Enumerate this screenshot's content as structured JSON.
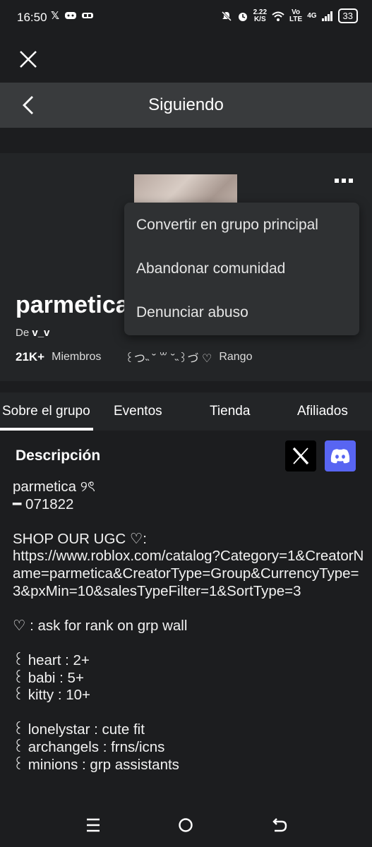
{
  "status_bar": {
    "time": "16:50",
    "net_speed_top": "2.22",
    "net_speed_bottom": "K/S",
    "volte_top": "Vo",
    "volte_bottom": "LTE",
    "network": "4G",
    "battery": "33"
  },
  "header": {
    "title": "Siguiendo"
  },
  "group": {
    "name": "parmetica",
    "owner_prefix": "De",
    "owner": "v_v",
    "members_count": "21K+",
    "members_label": "Miembros",
    "rank_value": "꒰つ˵ ˘ ꒳ ˘˵꒱づ ♡",
    "rank_label": "Rango"
  },
  "menu": {
    "items": [
      "Convertir en grupo principal",
      "Abandonar comunidad",
      "Denunciar abuso"
    ]
  },
  "tabs": [
    "Sobre el grupo",
    "Eventos",
    "Tienda",
    "Afiliados"
  ],
  "content": {
    "title": "Descripción",
    "description_lines": [
      "parmetica ୨ৎ",
      "━ 071822",
      "",
      "SHOP OUR UGC ♡:",
      "https://www.roblox.com/catalog?Category=1&CreatorName=parmetica&CreatorType=Group&CurrencyType=3&pxMin=10&salesTypeFilter=1&SortType=3",
      "",
      "♡ : ask for rank on grp wall",
      "",
      "꒰ heart : 2+",
      "꒰ babi : 5+",
      "꒰ kitty : 10+",
      "",
      "꒰ lonelystar : cute fit",
      "꒰ archangels : frns/icns",
      "꒰ minions : grp assistants"
    ]
  }
}
